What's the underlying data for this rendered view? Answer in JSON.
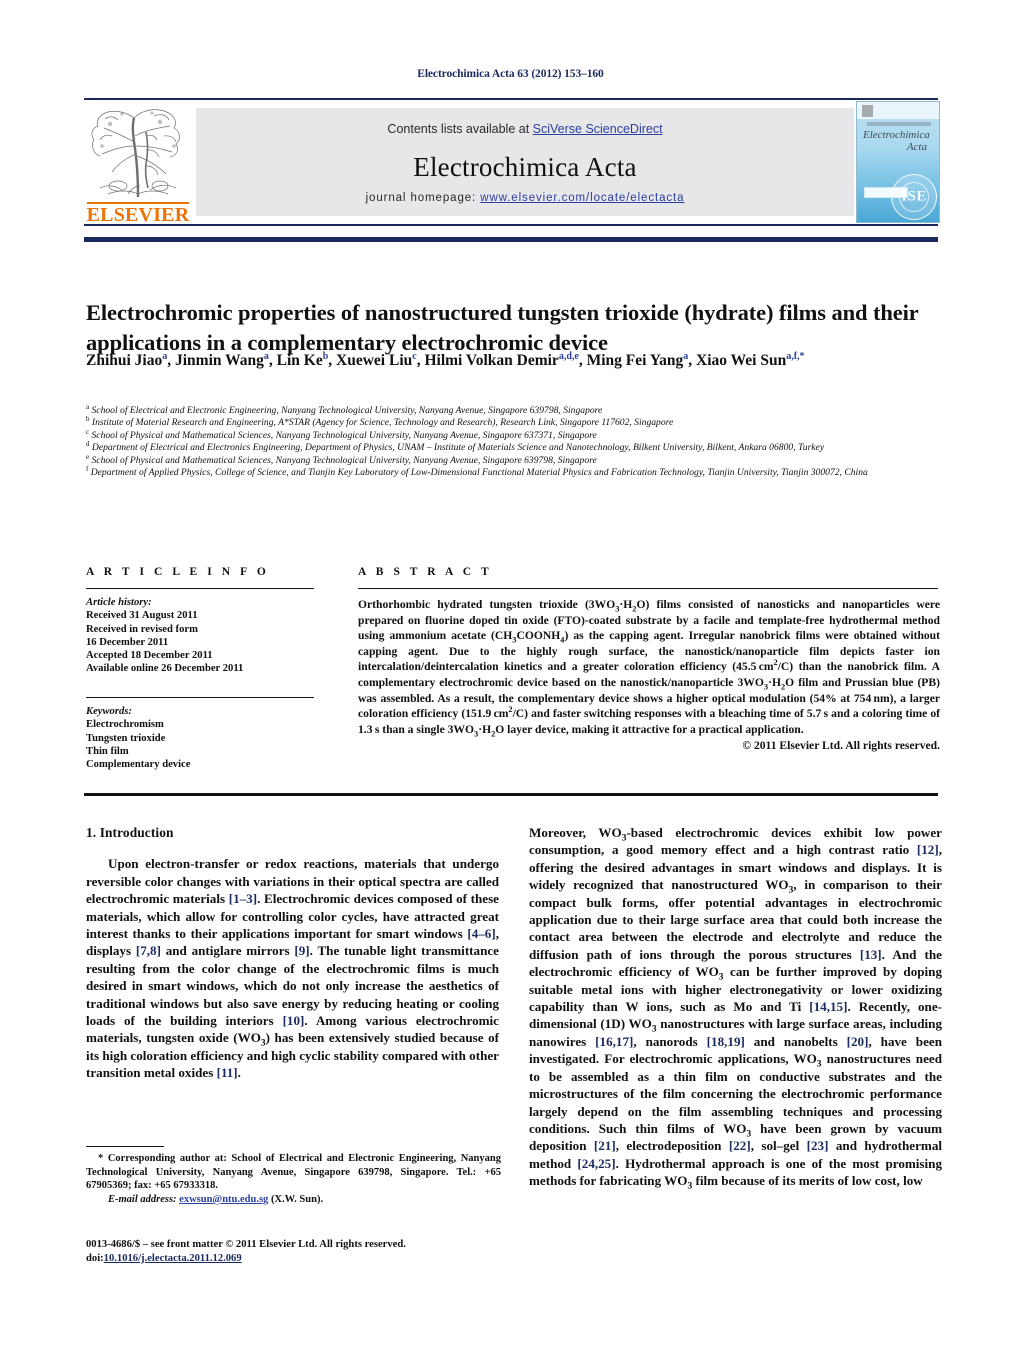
{
  "running_head": "Electrochimica Acta 63 (2012) 153–160",
  "masthead": {
    "contents_prefix": "Contents lists available at ",
    "sciencedirect": "SciVerse ScienceDirect",
    "journal_title": "Electrochimica Acta",
    "homepage_label": "journal homepage: ",
    "homepage_url": "www.elsevier.com/locate/electacta",
    "publisher": "ELSEVIER",
    "cover": {
      "title_line1": "Electrochimica",
      "title_line2": "Acta",
      "seal_text": "ISE"
    },
    "accent_navy": "#1b2a5e",
    "link_blue": "#2b3fa0",
    "elsevier_orange": "#ec7404",
    "band_grey": "#e7e7e9"
  },
  "title": "Electrochromic properties of nanostructured tungsten trioxide (hydrate) films and their applications in a complementary electrochromic device",
  "authors": [
    {
      "name": "Zhihui Jiao",
      "marks": "a"
    },
    {
      "name": "Jinmin Wang",
      "marks": "a"
    },
    {
      "name": "Lin Ke",
      "marks": "b"
    },
    {
      "name": "Xuewei Liu",
      "marks": "c"
    },
    {
      "name": "Hilmi Volkan Demir",
      "marks": "a,d,e"
    },
    {
      "name": "Ming Fei Yang",
      "marks": "a"
    },
    {
      "name": "Xiao Wei Sun",
      "marks": "a,f,*"
    }
  ],
  "affiliations": [
    {
      "mark": "a",
      "text": "School of Electrical and Electronic Engineering, Nanyang Technological University, Nanyang Avenue, Singapore 639798, Singapore"
    },
    {
      "mark": "b",
      "text": "Institute of Material Research and Engineering, A*STAR (Agency for Science, Technology and Research), Research Link, Singapore 117602, Singapore"
    },
    {
      "mark": "c",
      "text": "School of Physical and Mathematical Sciences, Nanyang Technological University, Nanyang Avenue, Singapore 637371, Singapore"
    },
    {
      "mark": "d",
      "text": "Department of Electrical and Electronics Engineering, Department of Physics, UNAM – Institute of Materials Science and Nanotechnology, Bilkent University, Bilkent, Ankara 06800, Turkey"
    },
    {
      "mark": "e",
      "text": "School of Physical and Mathematical Sciences, Nanyang Technological University, Nanyang Avenue, Singapore 639798, Singapore"
    },
    {
      "mark": "f",
      "text": "Department of Applied Physics, College of Science, and Tianjin Key Laboratory of Low-Dimensional Functional Material Physics and Fabrication Technology, Tianjin University, Tianjin 300072, China"
    }
  ],
  "article_info": {
    "heading": "A R T I C L E   I N F O",
    "history_label": "Article history:",
    "history": [
      "Received 31 August 2011",
      "Received in revised form",
      "16 December 2011",
      "Accepted 18 December 2011",
      "Available online 26 December 2011"
    ],
    "keywords_label": "Keywords:",
    "keywords": [
      "Electrochromism",
      "Tungsten trioxide",
      "Thin film",
      "Complementary device"
    ]
  },
  "abstract": {
    "heading": "A B S T R A C T",
    "copyright": "© 2011 Elsevier Ltd. All rights reserved."
  },
  "body": {
    "section_heading": "1.  Introduction"
  },
  "footnote": {
    "corresponding": "* Corresponding author at: School of Electrical and Electronic Engineering, Nanyang Technological University, Nanyang Avenue, Singapore 639798, Singapore. Tel.: +65 67905369; fax: +65 67933318.",
    "email_label": "E-mail address:",
    "email": "exwsun@ntu.edu.sg",
    "email_owner": "(X.W. Sun)."
  },
  "imprint": {
    "issn_line": "0013-4686/$ – see front matter © 2011 Elsevier Ltd. All rights reserved.",
    "doi_label": "doi:",
    "doi_value": "10.1016/j.electacta.2011.12.069"
  }
}
